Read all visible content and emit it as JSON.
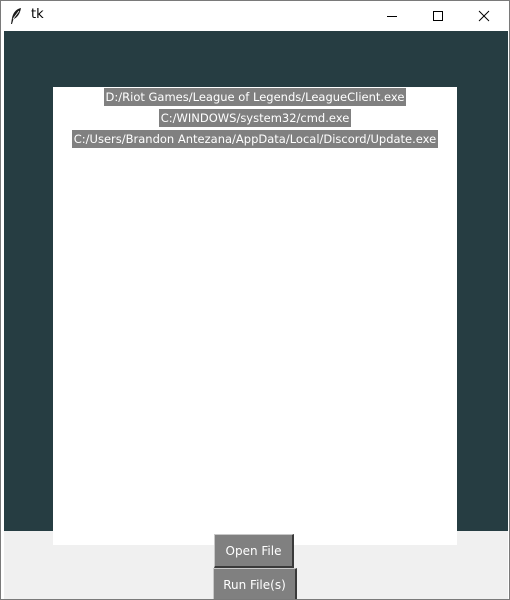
{
  "window": {
    "title": "tk",
    "minimize_icon": "minimize-icon",
    "maximize_icon": "maximize-icon",
    "close_icon": "close-icon",
    "app_icon": "feather-icon"
  },
  "colors": {
    "canvas_bg": "#263d42",
    "frame_bg": "#ffffff",
    "label_bg": "#808080",
    "label_fg": "#ffffff",
    "bottom_bg": "#f0f0f0"
  },
  "files": [
    "D:/Riot Games/League of Legends/LeagueClient.exe",
    "C:/WINDOWS/system32/cmd.exe",
    "C:/Users/Brandon Antezana/AppData/Local/Discord/Update.exe"
  ],
  "buttons": {
    "open_file": "Open File",
    "run_files": "Run File(s)"
  }
}
